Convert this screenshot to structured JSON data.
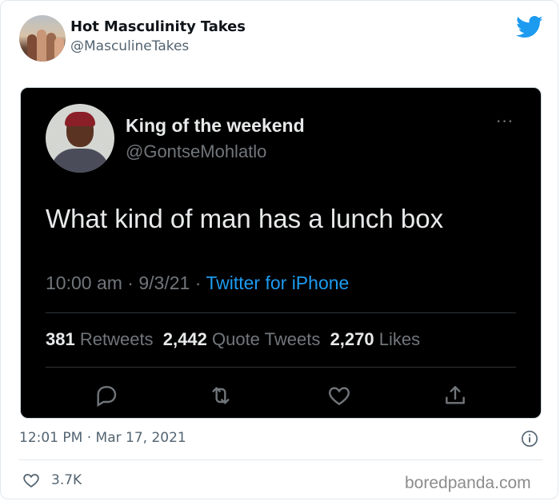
{
  "outer": {
    "display_name": "Hot Masculinity Takes",
    "handle": "@MasculineTakes",
    "timestamp": "12:01 PM · Mar 17, 2021",
    "like_count": "3.7K",
    "icons": [
      "twitter-bird-icon",
      "info-icon",
      "heart-icon"
    ],
    "accent": "#1d9bf0"
  },
  "embedded": {
    "display_name": "King of the weekend",
    "handle": "@GontseMohlatlo",
    "more": "···",
    "text": "What kind of man has a lunch box",
    "time": "10:00 am",
    "sep1": " · ",
    "date": "9/3/21",
    "sep2": " · ",
    "source": "Twitter for iPhone",
    "retweets": "381",
    "retweets_label": "Retweets",
    "quotes": "2,442",
    "quotes_label": "Quote Tweets",
    "likes": "2,270",
    "likes_label": "Likes",
    "actions": [
      "reply-icon",
      "retweet-icon",
      "like-icon",
      "share-icon"
    ],
    "background": "#000000"
  },
  "watermark": "boredpanda.com"
}
